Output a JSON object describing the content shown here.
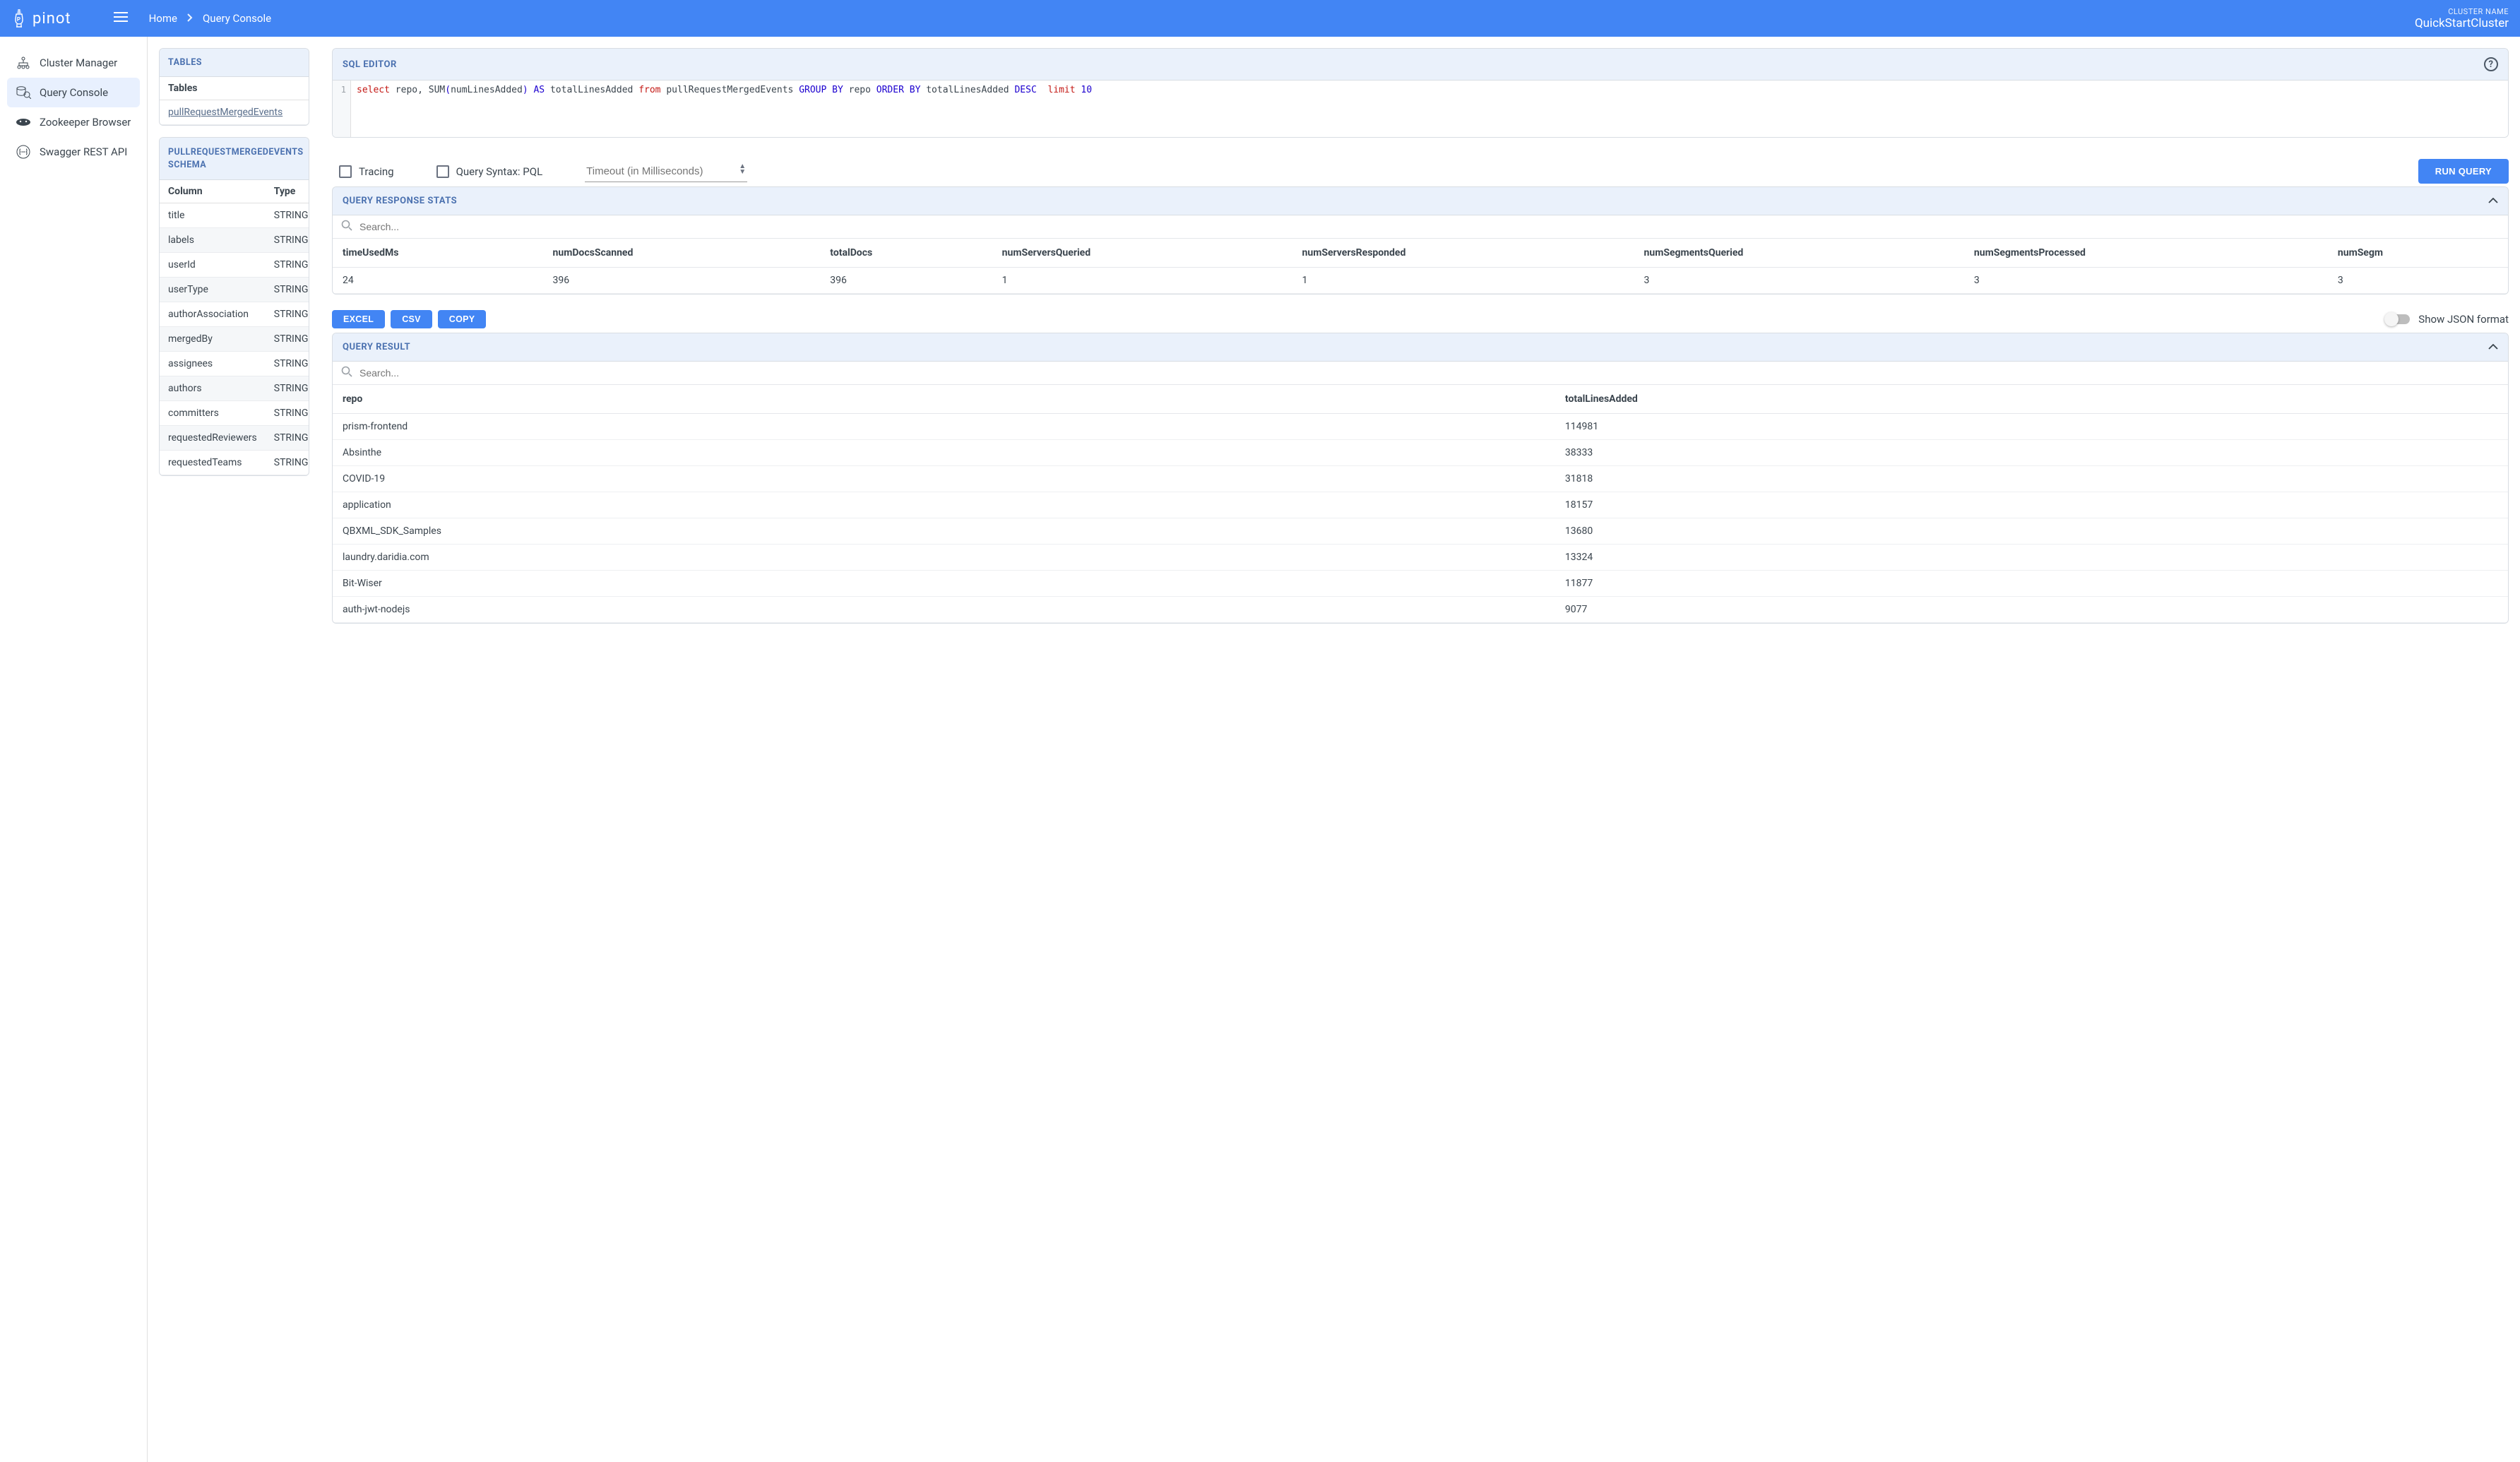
{
  "header": {
    "logo_text": "pinot",
    "breadcrumb": [
      "Home",
      "Query Console"
    ],
    "cluster_label": "CLUSTER NAME",
    "cluster_name": "QuickStartCluster"
  },
  "sidebar": {
    "items": [
      {
        "label": "Cluster Manager"
      },
      {
        "label": "Query Console"
      },
      {
        "label": "Zookeeper Browser"
      },
      {
        "label": "Swagger REST API"
      }
    ],
    "active_index": 1
  },
  "tables_panel": {
    "title": "TABLES",
    "col_header": "Tables",
    "rows": [
      "pullRequestMergedEvents"
    ]
  },
  "schema_panel": {
    "title": "PULLREQUESTMERGEDEVENTS SCHEMA",
    "headers": [
      "Column",
      "Type"
    ],
    "rows": [
      {
        "col": "title",
        "type": "STRING"
      },
      {
        "col": "labels",
        "type": "STRING"
      },
      {
        "col": "userId",
        "type": "STRING"
      },
      {
        "col": "userType",
        "type": "STRING"
      },
      {
        "col": "authorAssociation",
        "type": "STRING"
      },
      {
        "col": "mergedBy",
        "type": "STRING"
      },
      {
        "col": "assignees",
        "type": "STRING"
      },
      {
        "col": "authors",
        "type": "STRING"
      },
      {
        "col": "committers",
        "type": "STRING"
      },
      {
        "col": "requestedReviewers",
        "type": "STRING"
      },
      {
        "col": "requestedTeams",
        "type": "STRING"
      }
    ]
  },
  "sql_editor": {
    "title": "SQL EDITOR",
    "line_no": "1",
    "tokens": {
      "select": "select",
      "repo_comma": " repo, ",
      "sum": "SUM",
      "lparen": "(",
      "arg": "numLinesAdded",
      "rparen": ")",
      "sp1": " ",
      "as": "AS",
      "alias": " totalLinesAdded ",
      "from": "from",
      "table": " pullRequestMergedEvents ",
      "group_by": "GROUP BY",
      "gb_col": " repo ",
      "order_by": "ORDER BY",
      "ob_col": " totalLinesAdded ",
      "desc": "DESC",
      "sp2": "  ",
      "limit": "limit",
      "sp3": " ",
      "ten": "10"
    }
  },
  "controls": {
    "tracing_label": "Tracing",
    "pql_label": "Query Syntax: PQL",
    "timeout_placeholder": "Timeout (in Milliseconds)",
    "run_label": "RUN QUERY"
  },
  "stats": {
    "title": "QUERY RESPONSE STATS",
    "search_placeholder": "Search...",
    "headers": [
      "timeUsedMs",
      "numDocsScanned",
      "totalDocs",
      "numServersQueried",
      "numServersResponded",
      "numSegmentsQueried",
      "numSegmentsProcessed",
      "numSegm"
    ],
    "row": [
      "24",
      "396",
      "396",
      "1",
      "1",
      "3",
      "3",
      "3"
    ]
  },
  "exports": {
    "excel": "EXCEL",
    "csv": "CSV",
    "copy": "COPY",
    "json_label": "Show JSON format"
  },
  "result": {
    "title": "QUERY RESULT",
    "search_placeholder": "Search...",
    "headers": [
      "repo",
      "totalLinesAdded"
    ],
    "rows": [
      {
        "repo": "prism-frontend",
        "val": "114981"
      },
      {
        "repo": "Absinthe",
        "val": "38333"
      },
      {
        "repo": "COVID-19",
        "val": "31818"
      },
      {
        "repo": "application",
        "val": "18157"
      },
      {
        "repo": "QBXML_SDK_Samples",
        "val": "13680"
      },
      {
        "repo": "laundry.daridia.com",
        "val": "13324"
      },
      {
        "repo": "Bit-Wiser",
        "val": "11877"
      },
      {
        "repo": "auth-jwt-nodejs",
        "val": "9077"
      }
    ]
  }
}
